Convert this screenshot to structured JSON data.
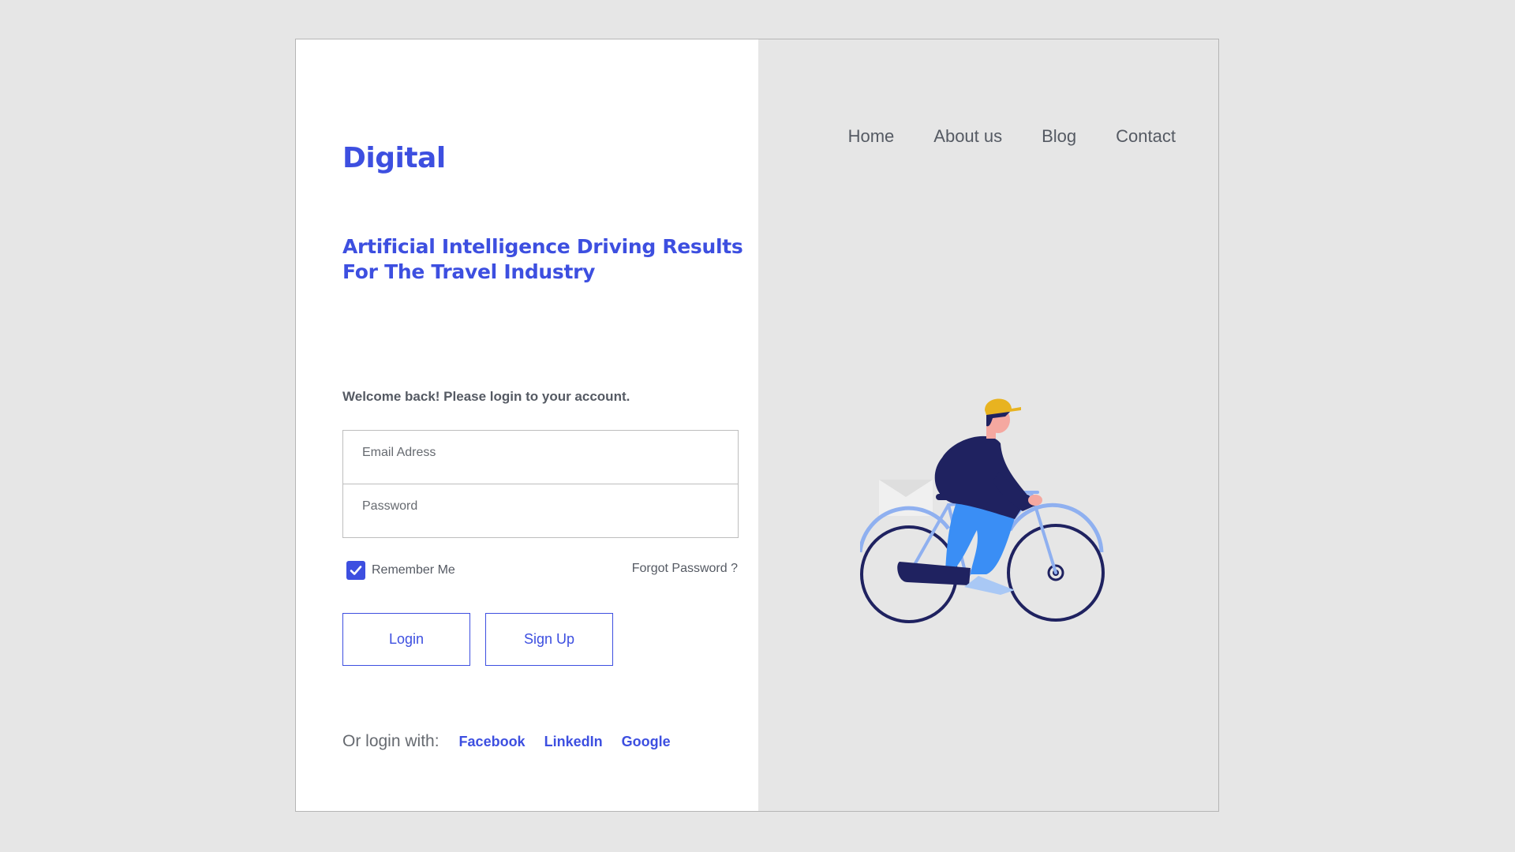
{
  "brand": {
    "name": "Digital",
    "tagline": "Artificial Intelligence Driving Results For The Travel Industry"
  },
  "login_form": {
    "welcome": "Welcome back! Please login to your account.",
    "email_placeholder": "Email Adress",
    "password_placeholder": "Password",
    "remember_label": "Remember Me",
    "remember_checked": true,
    "forgot_label": "Forgot Password ?",
    "login_label": "Login",
    "signup_label": "Sign Up"
  },
  "social": {
    "label": "Or login with:",
    "providers": [
      "Facebook",
      "LinkedIn",
      "Google"
    ]
  },
  "nav": {
    "items": [
      "Home",
      "About us",
      "Blog",
      "Contact"
    ]
  },
  "illustration": {
    "icon": "cyclist-illustration",
    "colors": {
      "wheel": "#1f2260",
      "frame": "#8fb0f0",
      "jacket": "#1f2260",
      "pants": "#3a8ef5",
      "cap": "#e8b320",
      "skin": "#f5a8a0",
      "envelope": "#ededed"
    }
  },
  "colors": {
    "accent": "#3d4fe0",
    "text_muted": "#555a63",
    "panel_bg": "#e6e6e6",
    "card_bg": "#ffffff"
  }
}
